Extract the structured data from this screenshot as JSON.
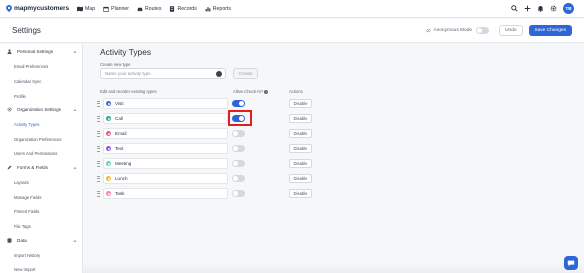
{
  "nav": {
    "brand": "mapmycustomers",
    "links": [
      {
        "label": "Map",
        "icon": "map-icon"
      },
      {
        "label": "Planner",
        "icon": "calendar-icon"
      },
      {
        "label": "Routes",
        "icon": "car-icon"
      },
      {
        "label": "Records",
        "icon": "records-icon"
      },
      {
        "label": "Reports",
        "icon": "reports-icon"
      }
    ],
    "avatar_initials": "TB",
    "accent": "#2f66d6"
  },
  "header": {
    "title": "Settings",
    "anonymous_mode_label": "Anonymous Mode",
    "undo_label": "Undo",
    "save_label": "Save Changes"
  },
  "sidebar": {
    "sections": [
      {
        "label": "Personal Settings",
        "icon": "person-icon",
        "items": [
          "Email Preferences",
          "Calendar Sync",
          "Profile"
        ]
      },
      {
        "label": "Organization Settings",
        "icon": "gear-icon",
        "items": [
          "Activity Types",
          "Organization Preferences",
          "Users And Permissions"
        ]
      },
      {
        "label": "Forms & Fields",
        "icon": "pencil-icon",
        "items": [
          "Layouts",
          "Manage Fields",
          "Pinned Fields",
          "File Tags"
        ]
      },
      {
        "label": "Data",
        "icon": "database-icon",
        "items": [
          "Import History",
          "New Import"
        ]
      }
    ],
    "active_item": "Activity Types"
  },
  "main": {
    "title": "Activity Types",
    "create_label": "Create new type",
    "create_placeholder": "Name your activity type",
    "create_button": "Create",
    "col_types": "Edit and reorder existing types",
    "col_checkin": "Allow Check-In?",
    "col_actions": "Actions",
    "disable_label": "Disable",
    "types": [
      {
        "name": "Visit",
        "color": "#3b6fd6",
        "checkin": true
      },
      {
        "name": "Call",
        "color": "#36a889",
        "checkin": true
      },
      {
        "name": "Email",
        "color": "#e0607a",
        "checkin": false
      },
      {
        "name": "Text",
        "color": "#8e56d6",
        "checkin": false
      },
      {
        "name": "Meeting",
        "color": "#5fd3c0",
        "checkin": false
      },
      {
        "name": "Lunch",
        "color": "#f0b840",
        "checkin": false
      },
      {
        "name": "Task",
        "color": "#f08aa0",
        "checkin": false
      }
    ]
  }
}
